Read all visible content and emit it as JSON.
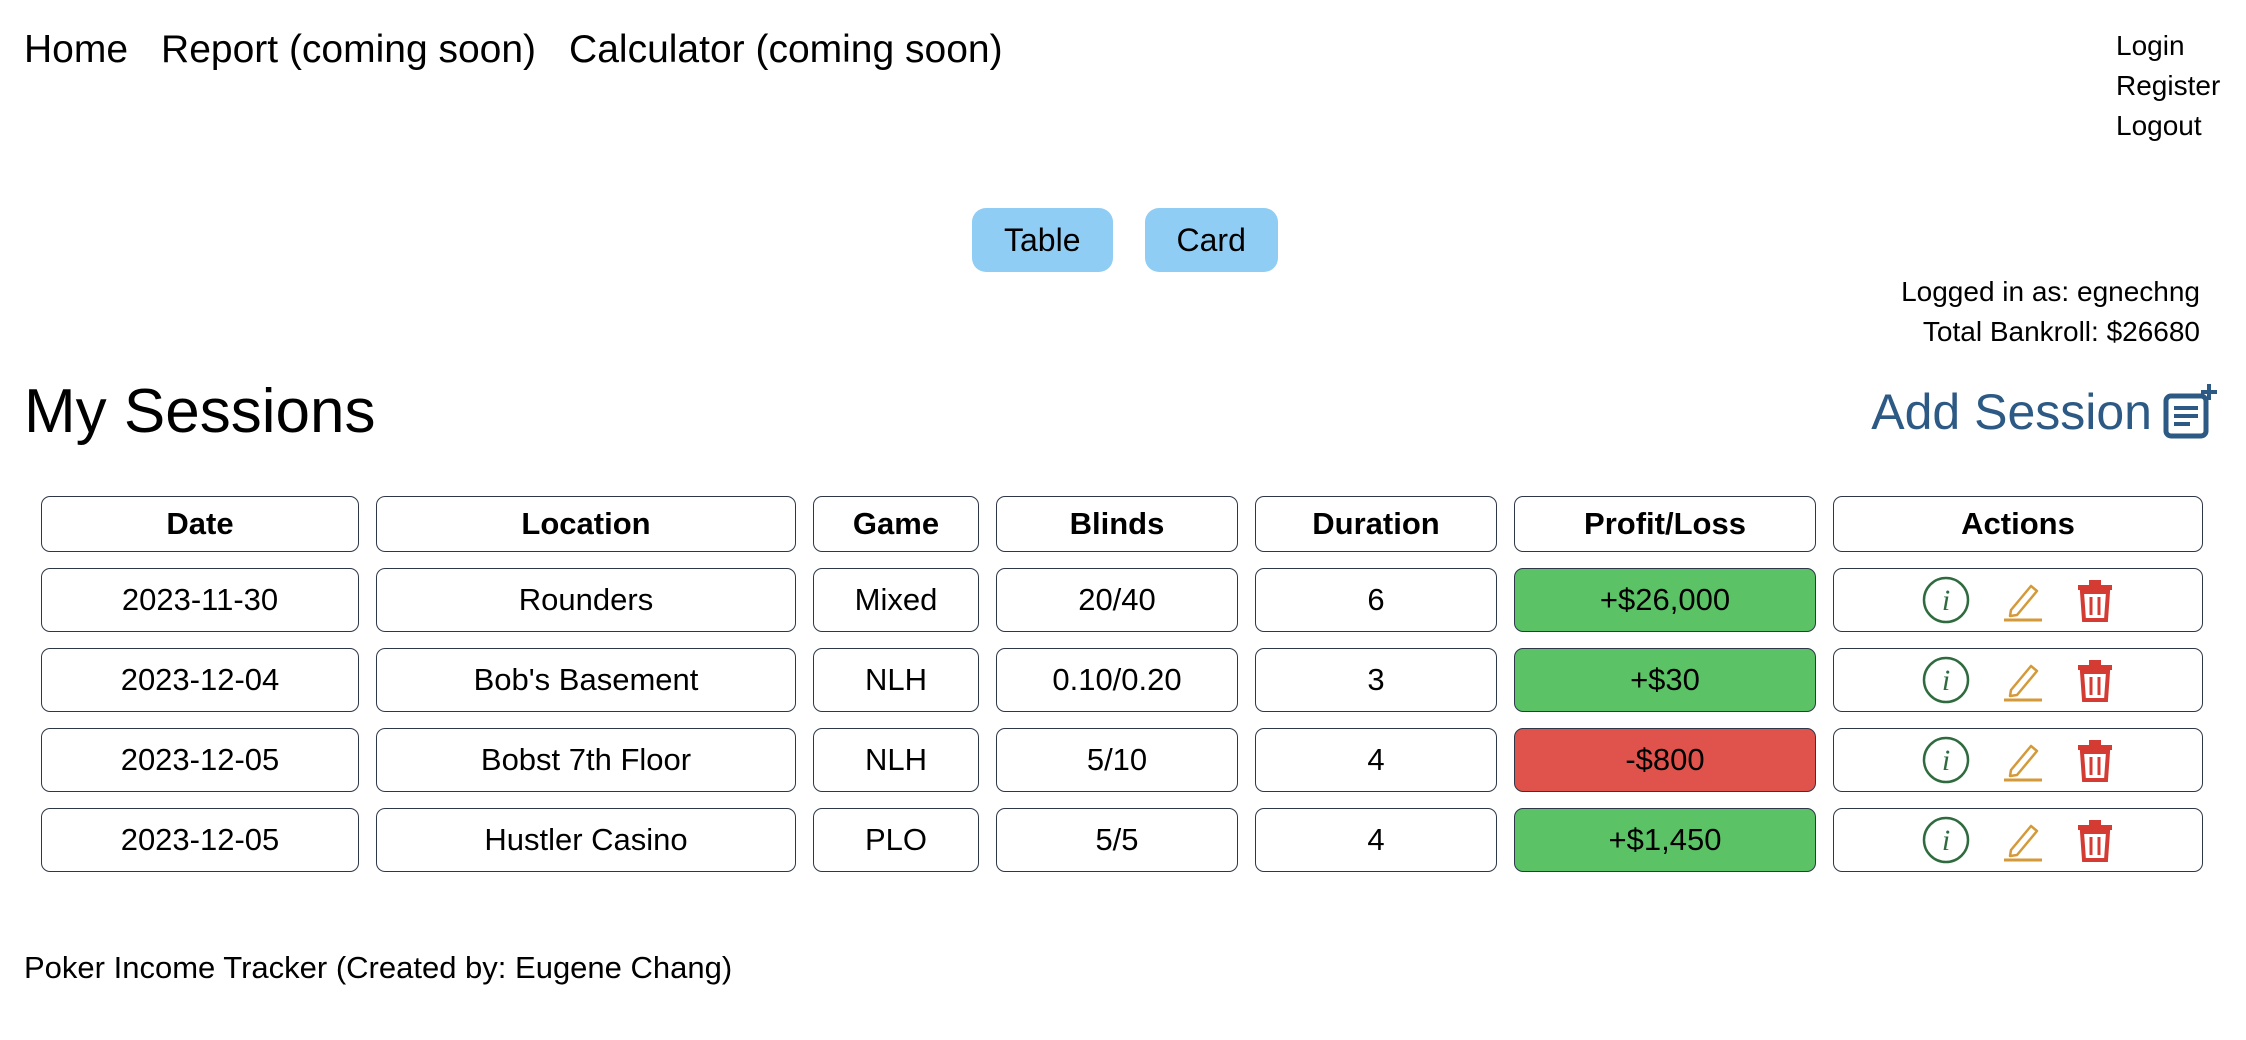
{
  "nav": {
    "home": "Home",
    "report": "Report (coming soon)",
    "calculator": "Calculator (coming soon)"
  },
  "auth": {
    "login": "Login",
    "register": "Register",
    "logout": "Logout"
  },
  "view_toggle": {
    "table": "Table",
    "card": "Card"
  },
  "user_info": {
    "logged_in": "Logged in as: egnechng",
    "bankroll": "Total Bankroll: $26680"
  },
  "page_title": "My Sessions",
  "add_session": {
    "label": "Add Session",
    "icon": "add-note-icon"
  },
  "table": {
    "headers": [
      "Date",
      "Location",
      "Game",
      "Blinds",
      "Duration",
      "Profit/Loss",
      "Actions"
    ],
    "rows": [
      {
        "date": "2023-11-30",
        "location": "Rounders",
        "game": "Mixed",
        "blinds": "20/40",
        "duration": "6",
        "profit": "+$26,000",
        "status": "positive"
      },
      {
        "date": "2023-12-04",
        "location": "Bob's Basement",
        "game": "NLH",
        "blinds": "0.10/0.20",
        "duration": "3",
        "profit": "+$30",
        "status": "positive"
      },
      {
        "date": "2023-12-05",
        "location": "Bobst 7th Floor",
        "game": "NLH",
        "blinds": "5/10",
        "duration": "4",
        "profit": "-$800",
        "status": "negative"
      },
      {
        "date": "2023-12-05",
        "location": "Hustler Casino",
        "game": "PLO",
        "blinds": "5/5",
        "duration": "4",
        "profit": "+$1,450",
        "status": "positive"
      }
    ]
  },
  "action_icons": [
    "info-icon",
    "pencil-icon",
    "trash-icon"
  ],
  "colors": {
    "positive": "#5bc266",
    "negative": "#e0524c",
    "toggle_bg": "#90cdf4",
    "accent": "#2c5a84",
    "info": "#2f6b3f",
    "edit": "#d49a3a",
    "delete": "#d33b33"
  },
  "footer": "Poker Income Tracker (Created by: Eugene Chang)"
}
